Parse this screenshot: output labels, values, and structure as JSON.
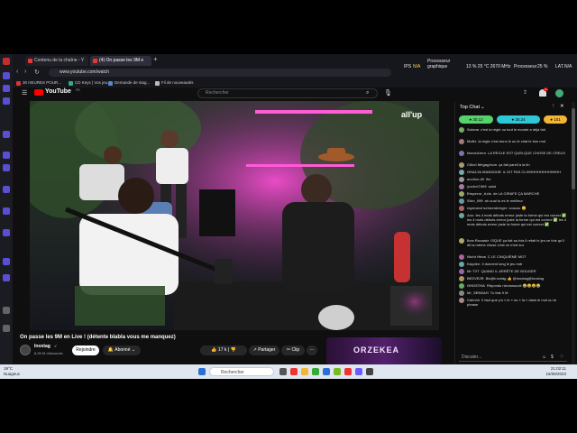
{
  "browser": {
    "tabs": [
      {
        "label": "Contenu de la chaîne - Y"
      },
      {
        "label": "(4) On passe les 9M e"
      }
    ],
    "new_tab": "+",
    "url": "www.youtube.com/watch",
    "bookmarks": [
      {
        "label": "30 HEURES POUR..."
      },
      {
        "label": "CD Keys | Vos jeu..."
      },
      {
        "label": "Demande de stag..."
      },
      {
        "label": "Fil de nouveautés"
      }
    ]
  },
  "perf_overlay": {
    "fps_label": "IPS",
    "fps_value": "N/A",
    "cpu_label": "Processeur",
    "gpu_label": "graphique",
    "gpu_values": "13 % 25 °C 2670 MHz",
    "cpu_usage_label": "Processeur",
    "cpu_usage_value": "25 %",
    "lat_label": "LAT.",
    "lat_value": "N/A"
  },
  "youtube": {
    "logo": "YouTube",
    "logo_suffix": "FR",
    "search_placeholder": "Rechercher",
    "notif_count": "9+",
    "video": {
      "brand_overlay": "all'up",
      "title": "On passe les 9M en Live ! (détente blabla vous me manquez)",
      "channel": "Inoxtag",
      "subscribers": "8,99 M d'abonnés",
      "join": "Rejoindre",
      "subscribed": "Abonné",
      "likes": "17 k",
      "share": "Partager",
      "clip": "Clip",
      "more": "···",
      "ad_text": "ORZEKEA"
    }
  },
  "chat": {
    "title": "Top Chat",
    "pinned": [
      {
        "value": "30.12",
        "color": "#55d36b"
      },
      {
        "value": "30.24",
        "color": "#2dc7d6"
      },
      {
        "value": "101",
        "color": "#f2b632"
      }
    ],
    "messages": [
      {
        "author": "Solana",
        "text": "c'est la règle ou tout le monde a déjà fait",
        "color": "#7a6"
      },
      {
        "author": "Mofix",
        "text": "la règle c'est donc le ou le chat le bon mot",
        "color": "#a77"
      },
      {
        "author": "farmeAlero",
        "text": "LA REGLE EST QUELQUE CHOSE DE CREUX",
        "color": "#77a"
      },
      {
        "author": "Clikel Mégagirom",
        "text": "ça fait pareil à la fin",
        "color": "#a97"
      },
      {
        "author": "GHALYA MANSOUR",
        "text": "IL DIT PAS CLIHHHHHHHHHHHHH",
        "color": "#7aa"
      },
      {
        "author": "acclive.49",
        "text": "9m",
        "color": "#999"
      },
      {
        "author": "yuchei7469",
        "text": "salut",
        "color": "#a7a"
      },
      {
        "author": "Emperor_Axis",
        "text": "de LA GIRAFE ÇA MARCHE",
        "color": "#9a6"
      },
      {
        "author": "Shin_099",
        "text": "ah ouai tu es le meilleur",
        "color": "#69a"
      },
      {
        "author": "raymond schoenberger",
        "text": "coucou 😊",
        "color": "#a66"
      },
      {
        "author": "Axo",
        "text": "les 4 mots débuts erreur juste la forme qui est correct ✅ les 4 mots débuts erreur juste la forme qui est correct ✅ les 4 mots débuts erreur juste la forme qui est correct ✅",
        "color": "#6a9"
      },
      {
        "author": "Ikea Rosaatz",
        "text": "ISQUE ça fait au fois il refait le jeu ce fois qu'il dit la mème chose c'est ce n'est sur",
        "color": "#aa6"
      },
      {
        "author": "Nicht Hlma",
        "text": "C LE CINQUIÈME MOT",
        "color": "#a69"
      },
      {
        "author": "Kayden",
        "text": "Il donnent long le jeu mdr",
        "color": "#6aa"
      },
      {
        "author": "Mr TVT",
        "text": "QUAND IL ARRÊTE DE BOUGER",
        "color": "#96a"
      },
      {
        "author": "BEZVEZR",
        "text": "Bis@Inoxtag 👍 @Inoxtag@Inoxtag",
        "color": "#a96"
      },
      {
        "author": "GHOSTHA",
        "text": "Répondu nicrosssoolt 😂😂😂😂",
        "color": "#6a6"
      },
      {
        "author": "Mr_SENSAH",
        "text": "Tu fais 9 M",
        "color": "#888"
      },
      {
        "author": "Calevin",
        "text": "Il faut que y'a « le » ou « la » dans le mot ou la phrase",
        "color": "#a88"
      }
    ],
    "input_placeholder": "Discuter..."
  },
  "taskbar": {
    "weather_temp": "19°C",
    "weather_desc": "Nuageux",
    "search_placeholder": "Rechercher",
    "time": "21:02:11",
    "date": "16/06/2023"
  }
}
